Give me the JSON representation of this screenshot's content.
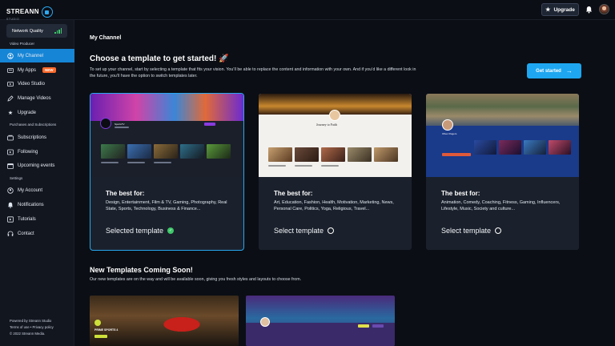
{
  "brand": {
    "name": "STREANN",
    "sub": "STUDIO"
  },
  "topbar": {
    "upgrade_label": "Upgrade"
  },
  "sidebar": {
    "network_quality": "Network Quality",
    "section_video_producer": "Video Producer",
    "items_producer": [
      {
        "label": "My Channel",
        "icon": "person-circle-icon",
        "active": true
      },
      {
        "label": "My Apps",
        "icon": "apps-icon",
        "badge": "NEW"
      },
      {
        "label": "Video Studio",
        "icon": "video-icon"
      },
      {
        "label": "Manage Videos",
        "icon": "edit-icon"
      },
      {
        "label": "Upgrade",
        "icon": "star-icon"
      }
    ],
    "section_purchases": "Purchases and Subscriptions",
    "items_purchases": [
      {
        "label": "Subscriptions",
        "icon": "subscriptions-icon"
      },
      {
        "label": "Following",
        "icon": "following-icon"
      },
      {
        "label": "Upcoming events",
        "icon": "calendar-icon"
      }
    ],
    "section_settings": "Settings",
    "items_settings": [
      {
        "label": "My Account",
        "icon": "account-icon"
      },
      {
        "label": "Notifications",
        "icon": "bell-icon"
      },
      {
        "label": "Tutorials",
        "icon": "tutorial-icon"
      },
      {
        "label": "Contact",
        "icon": "headset-icon"
      }
    ],
    "footer": [
      "Powered by Streann Studio",
      "Terms of use • Privacy policy",
      "© 2022 Streann Media."
    ]
  },
  "main": {
    "breadcrumb": "My Channel",
    "title": "Choose a template to get started! 🚀",
    "description": "To set up your channel, start by selecting a template that fits your vision. You’ll be able to replace the content and information with your own. And if you’d like a different look in the future, you’ll have the option to switch templates later.",
    "get_started": "Get started",
    "templates": [
      {
        "best_for": "The best for:",
        "categories": "Design, Entertainment, Film & TV, Gaming, Photography, Real State, Sports, Technology, Business & Finance...",
        "select_label": "Selected template",
        "selected": true
      },
      {
        "best_for": "The best for:",
        "categories": "Art, Education, Fashion, Health, Motivation, Marketing, News, Personal Care, Politics, Yoga, Religious, Travel...",
        "select_label": "Select template",
        "selected": false
      },
      {
        "best_for": "The best for:",
        "categories": "Animation, Comedy, Coaching, Fitness, Gaming, Influencers, Lifestyle, Music, Society and culture...",
        "select_label": "Select template",
        "selected": false
      }
    ],
    "thumb_texts": {
      "t1_channel": "SportsTV",
      "t2_channel": "Journey to Faith",
      "t3_channel": "Oliver Rogers",
      "u1_title": "PRIME SPORTS 4"
    },
    "coming_title": "New Templates Coming Soon!",
    "coming_desc": "Our new templates are on the way and will be available soon, giving you fresh styles and layouts to choose from."
  },
  "colors": {
    "accent": "#1ea7f0",
    "active_nav": "#1685d6",
    "badge": "#ff6a2b",
    "success": "#3ec96a"
  }
}
